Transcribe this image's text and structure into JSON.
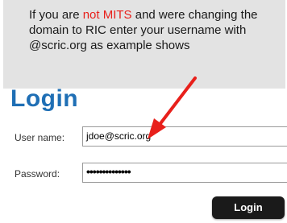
{
  "note": {
    "text_before": "If you are ",
    "highlight": "not MITS",
    "text_after": " and were changing the domain to RIC enter your username with @scric.org as example shows",
    "highlight_color": "#e8201b"
  },
  "login": {
    "title": "Login",
    "username_label": "User name:",
    "username_value": "jdoe@scric.org",
    "password_label": "Password:",
    "password_value": "••••••••••••••",
    "button_label": "Login"
  },
  "colors": {
    "title": "#1f6fb5",
    "note_bg": "#e3e3e3",
    "arrow": "#e8201b",
    "button_bg": "#1a1a1a"
  },
  "icons": {
    "annotation_arrow": "red-arrow-icon"
  }
}
